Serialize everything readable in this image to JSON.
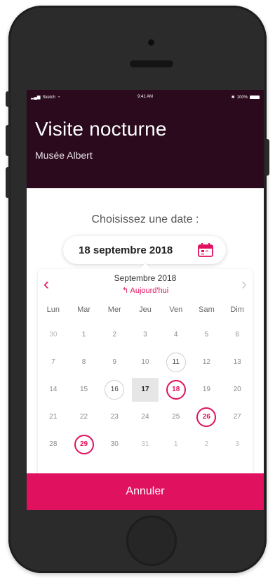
{
  "status_bar": {
    "carrier": "Sketch",
    "time": "9:41 AM",
    "battery": "100%"
  },
  "header": {
    "title": "Visite nocturne",
    "subtitle": "Musée Albert"
  },
  "prompt": "Choisissez une date :",
  "date_field": {
    "value": "18 septembre 2018",
    "icon": "calendar-icon"
  },
  "calendar": {
    "month_label": "Septembre 2018",
    "today_link": "Aujourd'hui",
    "weekdays": [
      "Lun",
      "Mar",
      "Mer",
      "Jeu",
      "Ven",
      "Sam",
      "Dim"
    ],
    "days": [
      {
        "label": "30",
        "state": "outside"
      },
      {
        "label": "1",
        "state": "normal"
      },
      {
        "label": "2",
        "state": "normal"
      },
      {
        "label": "3",
        "state": "normal"
      },
      {
        "label": "4",
        "state": "normal"
      },
      {
        "label": "5",
        "state": "normal"
      },
      {
        "label": "6",
        "state": "normal"
      },
      {
        "label": "7",
        "state": "normal"
      },
      {
        "label": "8",
        "state": "normal"
      },
      {
        "label": "9",
        "state": "normal"
      },
      {
        "label": "10",
        "state": "normal"
      },
      {
        "label": "11",
        "state": "outline-gray"
      },
      {
        "label": "12",
        "state": "normal"
      },
      {
        "label": "13",
        "state": "normal"
      },
      {
        "label": "14",
        "state": "normal"
      },
      {
        "label": "15",
        "state": "normal"
      },
      {
        "label": "16",
        "state": "outline-gray"
      },
      {
        "label": "17",
        "state": "today"
      },
      {
        "label": "18",
        "state": "outline-red"
      },
      {
        "label": "19",
        "state": "normal"
      },
      {
        "label": "20",
        "state": "normal"
      },
      {
        "label": "21",
        "state": "normal"
      },
      {
        "label": "22",
        "state": "normal"
      },
      {
        "label": "23",
        "state": "normal"
      },
      {
        "label": "24",
        "state": "normal"
      },
      {
        "label": "25",
        "state": "normal"
      },
      {
        "label": "26",
        "state": "outline-red"
      },
      {
        "label": "27",
        "state": "normal"
      },
      {
        "label": "28",
        "state": "normal"
      },
      {
        "label": "29",
        "state": "outline-red"
      },
      {
        "label": "30",
        "state": "normal"
      },
      {
        "label": "31",
        "state": "outside"
      },
      {
        "label": "1",
        "state": "outside"
      },
      {
        "label": "2",
        "state": "outside"
      },
      {
        "label": "3",
        "state": "outside"
      }
    ]
  },
  "cancel_button": "Annuler",
  "colors": {
    "header_bg": "#2a0a1c",
    "accent": "#e0115f"
  }
}
